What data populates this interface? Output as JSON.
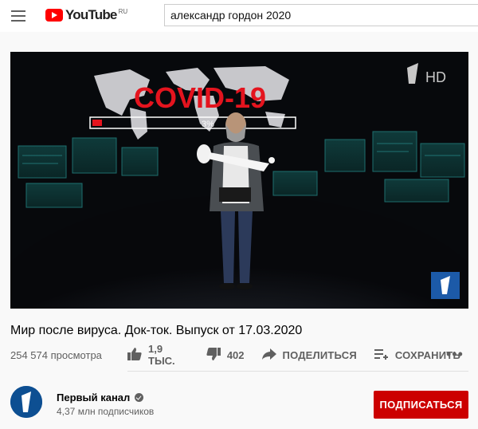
{
  "header": {
    "logo_text": "YouTube",
    "region": "RU",
    "search_value": "александр гордон 2020"
  },
  "video": {
    "overlay_text": "COVID-19",
    "overlay_percent": "3",
    "channel_watermark": "HD",
    "title": "Мир после вируса. Док-ток. Выпуск от 17.03.2020",
    "views": "254 574 просмотра",
    "likes": "1,9 ТЫС.",
    "dislikes": "402",
    "share_label": "ПОДЕЛИТЬСЯ",
    "save_label": "СОХРАНИТЬ",
    "more_label": "•••"
  },
  "channel": {
    "name": "Первый канал",
    "subscribers": "4,37 млн подписчиков",
    "subscribe_label": "ПОДПИСАТЬСЯ"
  },
  "colors": {
    "brand_red": "#ff0000",
    "subscribe_red": "#cc0000",
    "covid_red": "#e4141e"
  },
  "icons": [
    "hamburger-menu-icon",
    "youtube-play-icon",
    "thumbs-up-icon",
    "thumbs-down-icon",
    "share-arrow-icon",
    "add-to-playlist-icon",
    "more-dots-icon",
    "verified-check-icon"
  ]
}
